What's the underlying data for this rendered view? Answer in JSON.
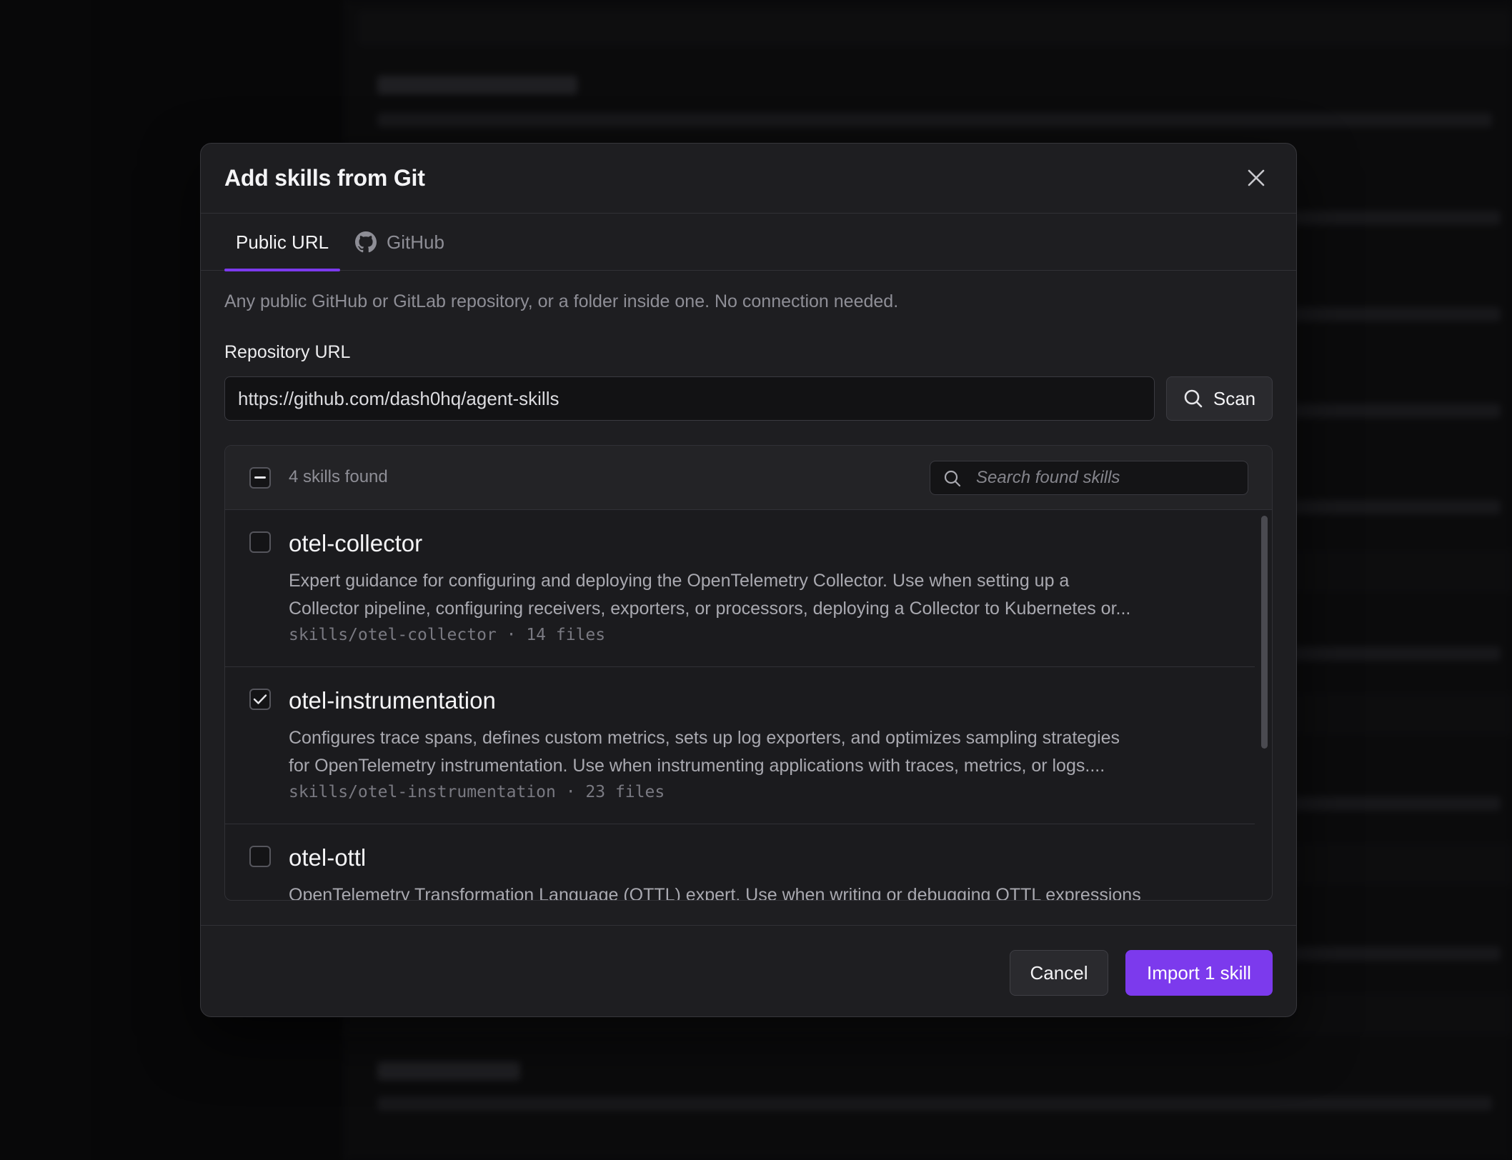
{
  "dialog": {
    "title": "Add skills from Git",
    "close_icon": "close-icon"
  },
  "tabs": [
    {
      "label": "Public URL",
      "active": true
    },
    {
      "label": "GitHub",
      "icon": "github-icon",
      "active": false
    }
  ],
  "public_url": {
    "hint": "Any public GitHub or GitLab repository, or a folder inside one. No connection needed.",
    "field_label": "Repository URL",
    "url_value": "https://github.com/dash0hq/agent-skills",
    "scan_label": "Scan",
    "scan_icon": "search-icon"
  },
  "results": {
    "found_text": "4 skills found",
    "select_all_state": "indeterminate",
    "search_placeholder": "Search found skills",
    "items": [
      {
        "name": "otel-collector",
        "checked": false,
        "desc_line1": "Expert guidance for configuring and deploying the OpenTelemetry Collector. Use when setting up a",
        "desc_line2": "Collector pipeline, configuring receivers, exporters, or processors, deploying a Collector to Kubernetes or...",
        "meta": "skills/otel-collector · 14 files"
      },
      {
        "name": "otel-instrumentation",
        "checked": true,
        "desc_line1": "Configures trace spans, defines custom metrics, sets up log exporters, and optimizes sampling strategies",
        "desc_line2": "for OpenTelemetry instrumentation. Use when instrumenting applications with traces, metrics, or logs....",
        "meta": "skills/otel-instrumentation · 23 files"
      },
      {
        "name": "otel-ottl",
        "checked": false,
        "desc_line1": "OpenTelemetry Transformation Language (OTTL) expert. Use when writing or debugging OTTL expressions",
        "desc_line2": "",
        "meta": ""
      }
    ]
  },
  "footer": {
    "cancel_label": "Cancel",
    "import_label": "Import 1 skill"
  },
  "colors": {
    "accent": "#7c3aed",
    "dialog_bg": "#1e1e21",
    "page_bg": "#111113"
  }
}
